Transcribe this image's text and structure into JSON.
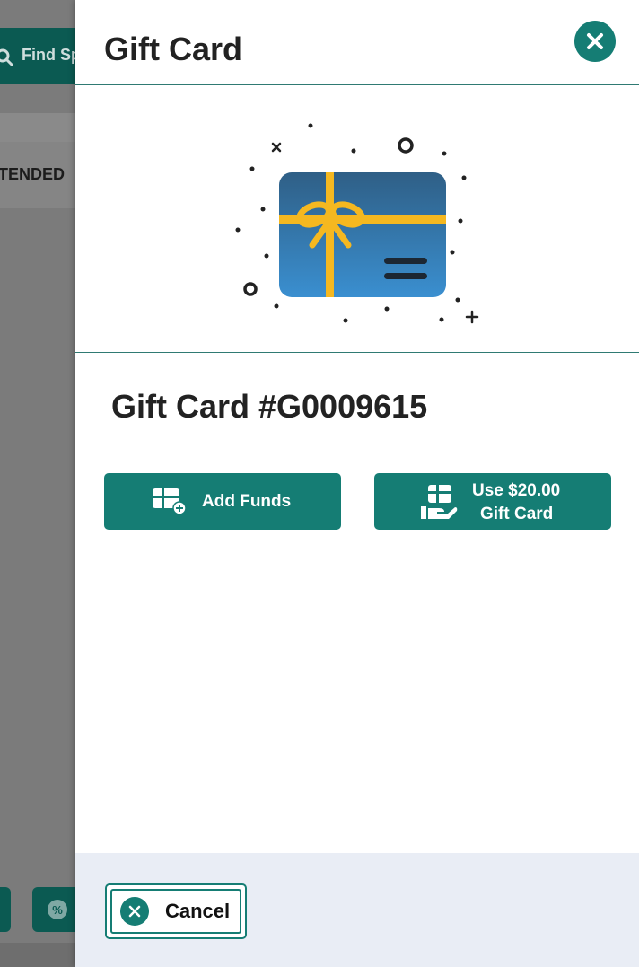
{
  "background": {
    "search_label": "Find Sp",
    "column_label": "TENDED",
    "search_icon": "search-icon",
    "discount_icon": "discount-badge-icon"
  },
  "drawer": {
    "title": "Gift Card",
    "close_icon": "close-icon",
    "hero_icon": "gift-card-illustration",
    "card_number": "Gift Card #G0009615",
    "add_funds": {
      "label": "Add Funds",
      "icon": "add-gift-card-icon"
    },
    "use_card": {
      "label_line1": "Use $20.00",
      "label_line2": "Gift Card",
      "icon": "hand-gift-card-icon"
    },
    "cancel": {
      "label": "Cancel",
      "icon": "close-circle-icon"
    }
  },
  "colors": {
    "accent": "#157d74",
    "card_gradient_top": "#2f5f86",
    "card_gradient_bottom": "#3a8fd0",
    "ribbon": "#f5b820",
    "footer_bg": "#e9edf5"
  }
}
